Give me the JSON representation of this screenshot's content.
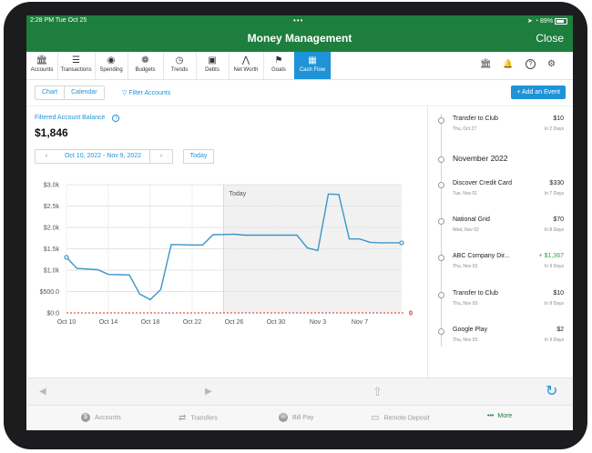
{
  "status": {
    "time": "2:28 PM   Tue Oct 25",
    "dots": "•••",
    "battery": "89%"
  },
  "header": {
    "title": "Money Management",
    "close": "Close"
  },
  "nav": {
    "items": [
      {
        "label": "Accounts",
        "icon": "bank-icon",
        "glyph": "🏛"
      },
      {
        "label": "Transactions",
        "icon": "list-icon",
        "glyph": "☰"
      },
      {
        "label": "Spending",
        "icon": "spending-icon",
        "glyph": "◉"
      },
      {
        "label": "Budgets",
        "icon": "budgets-icon",
        "glyph": "❁"
      },
      {
        "label": "Trends",
        "icon": "clock-icon",
        "glyph": "◷"
      },
      {
        "label": "Debts",
        "icon": "debts-icon",
        "glyph": "▣"
      },
      {
        "label": "Net Worth",
        "icon": "net-worth-icon",
        "glyph": "⋀"
      },
      {
        "label": "Goals",
        "icon": "goals-icon",
        "glyph": "⚑"
      },
      {
        "label": "Cash Flow",
        "icon": "cash-flow-icon",
        "glyph": "▦"
      }
    ],
    "right_icons": [
      {
        "name": "institution-icon",
        "glyph": "🏛"
      },
      {
        "name": "bell-icon",
        "glyph": "🔔"
      },
      {
        "name": "help-icon",
        "glyph": "?"
      },
      {
        "name": "settings-icon",
        "glyph": "⚙"
      }
    ]
  },
  "toolbar": {
    "chart": "Chart",
    "calendar": "Calendar",
    "filter": "Filter Accounts",
    "add_event": "+ Add an Event"
  },
  "summary": {
    "label": "Filtered Account Balance",
    "balance": "$1,846"
  },
  "range": {
    "prev": "‹",
    "text": "Oct 10, 2022 - Nov 9, 2022",
    "next": "›",
    "today": "Today"
  },
  "chart_data": {
    "type": "line",
    "y_ticks": [
      "$0.0",
      "$500.0",
      "$1.0k",
      "$1.5k",
      "$2.0k",
      "$2.5k",
      "$3.0k"
    ],
    "ylim": [
      0,
      3000
    ],
    "x_ticks": [
      {
        "label": "Oct 10",
        "day": 0
      },
      {
        "label": "Oct 14",
        "day": 4
      },
      {
        "label": "Oct 18",
        "day": 8
      },
      {
        "label": "Oct 22",
        "day": 12
      },
      {
        "label": "Oct 26",
        "day": 16
      },
      {
        "label": "Oct 30",
        "day": 20
      },
      {
        "label": "Nov 3",
        "day": 24
      },
      {
        "label": "Nov 7",
        "day": 28
      }
    ],
    "today_label": "Today",
    "today_day": 15,
    "end_value_label": "0",
    "points": [
      [
        0,
        1300
      ],
      [
        1,
        1040
      ],
      [
        3,
        1010
      ],
      [
        4,
        900
      ],
      [
        6,
        890
      ],
      [
        7,
        440
      ],
      [
        8,
        310
      ],
      [
        9,
        550
      ],
      [
        10,
        1600
      ],
      [
        12,
        1590
      ],
      [
        13,
        1590
      ],
      [
        14,
        1830
      ],
      [
        16,
        1840
      ],
      [
        17,
        1820
      ],
      [
        20,
        1820
      ],
      [
        22,
        1820
      ],
      [
        23,
        1520
      ],
      [
        24,
        1460
      ],
      [
        25,
        2780
      ],
      [
        26,
        2770
      ],
      [
        27,
        1730
      ],
      [
        28,
        1730
      ],
      [
        29,
        1650
      ],
      [
        30,
        1640
      ],
      [
        32,
        1640
      ]
    ],
    "accent": "#3a96c8",
    "zero_line_color": "#d42b2b"
  },
  "events": [
    {
      "name": "Transfer to Club",
      "date": "Thu, Oct 27",
      "amount": "$10",
      "days": "In 2 Days",
      "positive": false
    },
    {
      "name": "Discover Credit Card",
      "date": "Tue, Nov 01",
      "amount": "$330",
      "days": "In 7 Days",
      "positive": false
    },
    {
      "name": "National Grid",
      "date": "Wed, Nov 02",
      "amount": "$70",
      "days": "In 8 Days",
      "positive": false
    },
    {
      "name": "ABC Company Dir...",
      "date": "Thu, Nov 03",
      "amount": "+ $1,367",
      "days": "In 9 Days",
      "positive": true
    },
    {
      "name": "Transfer to Club",
      "date": "Thu, Nov 03",
      "amount": "$10",
      "days": "In 9 Days",
      "positive": false
    },
    {
      "name": "Google Play",
      "date": "Thu, Nov 03",
      "amount": "$2",
      "days": "In 9 Days",
      "positive": false
    }
  ],
  "month_header": "November 2022",
  "bottom": {
    "back": "◀",
    "forward": "▶",
    "share": "⇧",
    "refresh": "↻"
  },
  "tabs": [
    {
      "label": "Accounts",
      "glyph": "$"
    },
    {
      "label": "Transfers",
      "glyph": "⇄"
    },
    {
      "label": "Bill Pay",
      "glyph": "✉"
    },
    {
      "label": "Remote Deposit",
      "glyph": "▭"
    },
    {
      "label": "More",
      "glyph": "•••"
    }
  ]
}
